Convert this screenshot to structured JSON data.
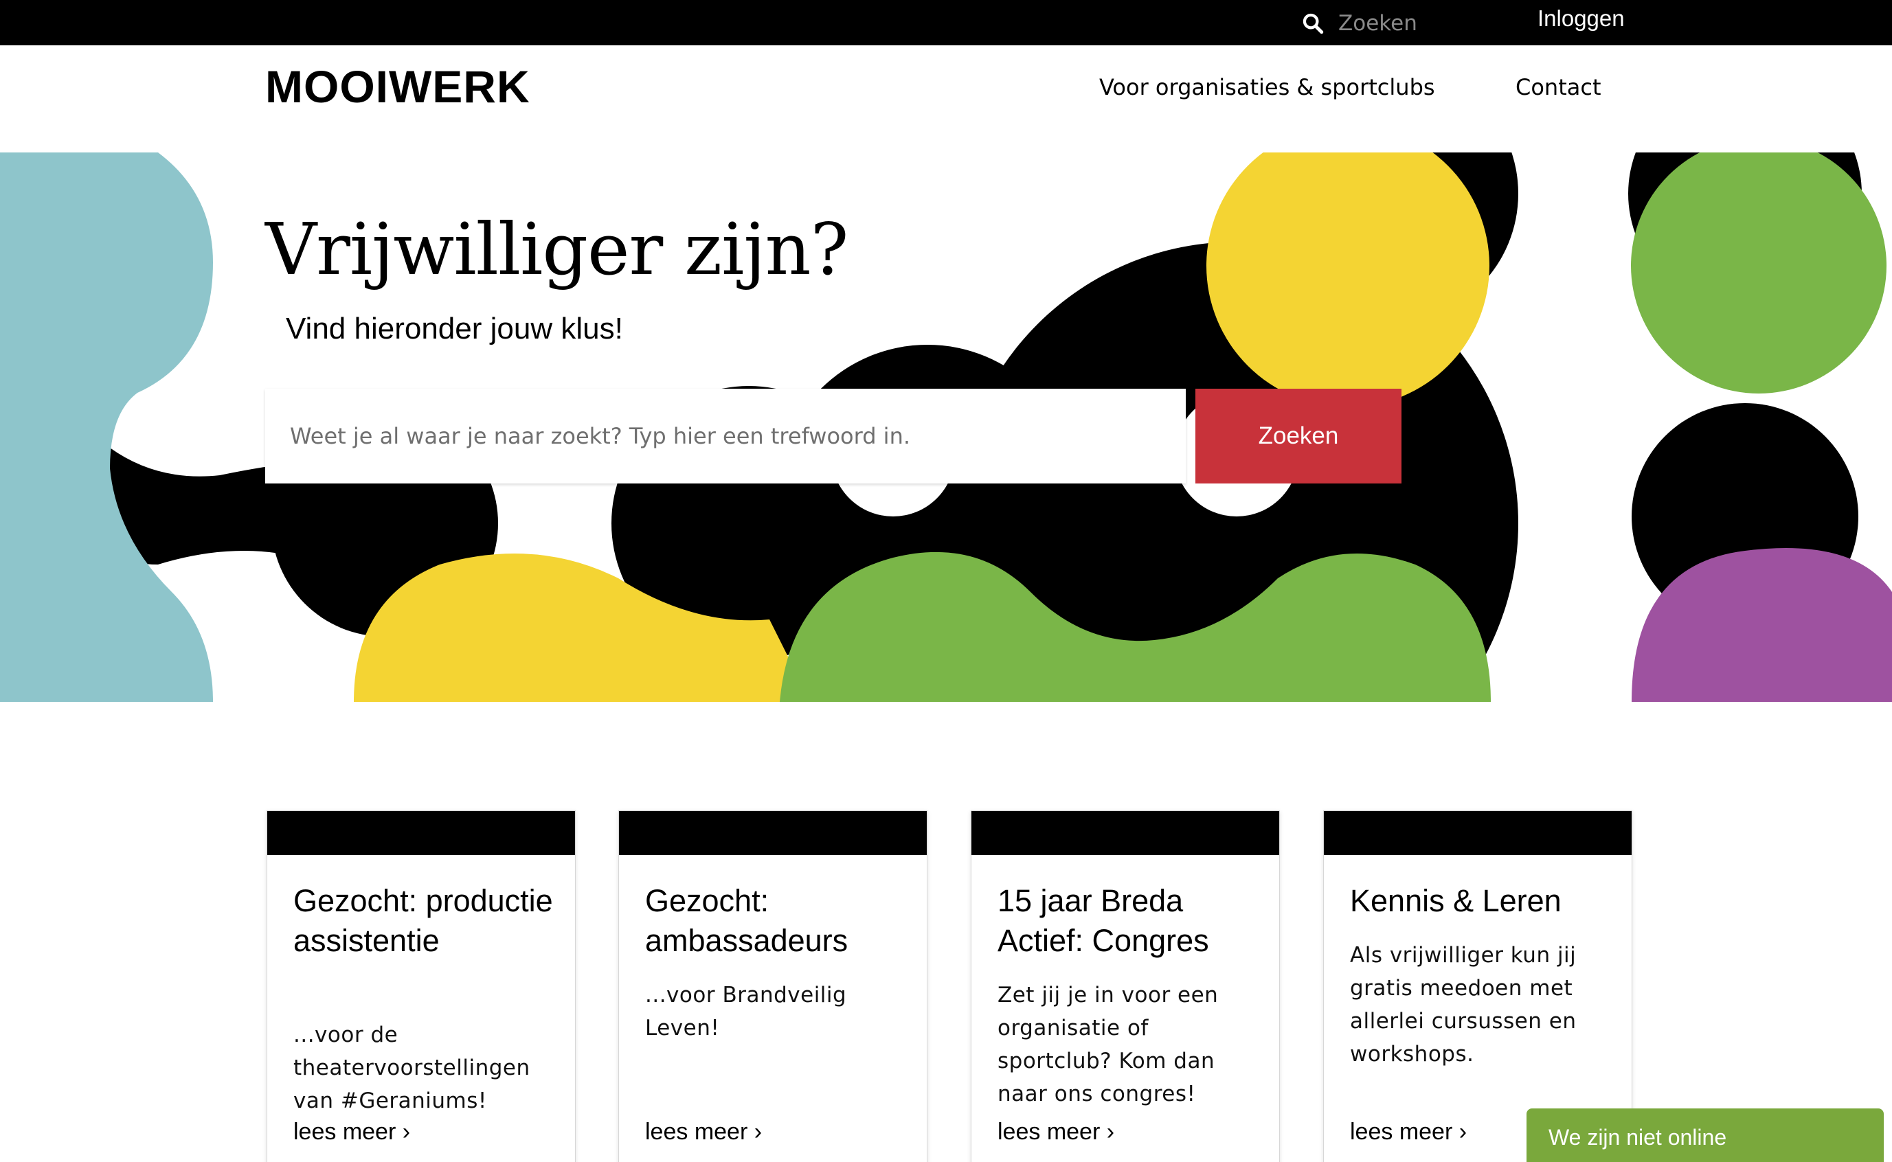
{
  "topbar": {
    "search_placeholder": "Zoeken",
    "login_label": "Inloggen"
  },
  "header": {
    "logo": "MOOIWERK",
    "nav": [
      "Voor organisaties & sportclubs",
      "Contact"
    ]
  },
  "hero": {
    "title": "Vrijwilliger zijn?",
    "subtitle": "Vind hieronder jouw klus!",
    "search_placeholder": "Weet je al waar je naar zoekt? Typ hier een trefwoord in.",
    "search_button": "Zoeken"
  },
  "cards": [
    {
      "title": "Gezocht: productie assistentie",
      "text": "...voor de theatervoorstellingen van #Geraniums!",
      "more": "lees meer ›"
    },
    {
      "title": "Gezocht: ambassadeurs",
      "text": "...voor Brandveilig Leven!",
      "more": "lees meer ›"
    },
    {
      "title": "15 jaar Breda Actief: Congres",
      "text": "Zet jij je in voor een organisatie of sportclub? Kom dan naar ons congres!",
      "more": "lees meer ›"
    },
    {
      "title": "Kennis & Leren",
      "text": "Als vrijwilliger kun jij gratis meedoen met allerlei cursussen en workshops.",
      "more": "lees meer ›"
    }
  ],
  "chat": {
    "status": "We zijn niet online"
  },
  "colors": {
    "brand_red": "#c8323a",
    "blue": "#8ec5cb",
    "yellow": "#f4d433",
    "green": "#7ab648",
    "purple": "#9e52a0",
    "black": "#000000",
    "chat_green": "#7aa83c"
  }
}
